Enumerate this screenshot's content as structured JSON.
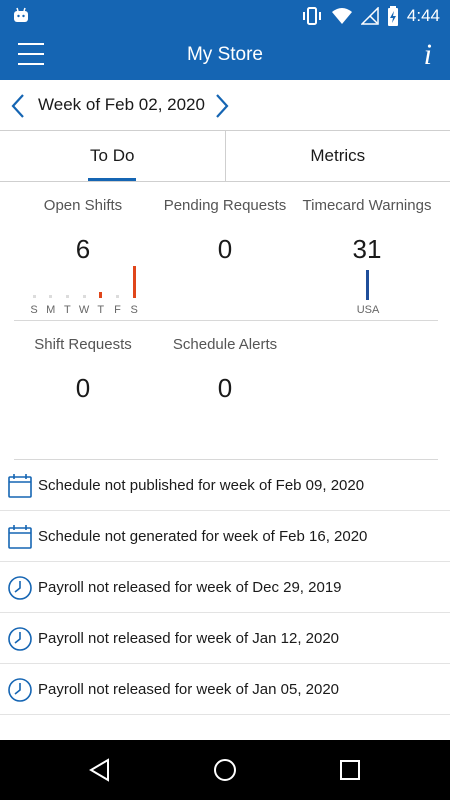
{
  "status_bar": {
    "time": "4:44"
  },
  "app_bar": {
    "title": "My Store",
    "info_icon": "i"
  },
  "week_nav": {
    "label": "Week of Feb 02, 2020"
  },
  "tabs": [
    {
      "label": "To Do",
      "active": true
    },
    {
      "label": "Metrics",
      "active": false
    }
  ],
  "summary": {
    "open_shifts": {
      "label": "Open Shifts",
      "value": "6"
    },
    "pending_requests": {
      "label": "Pending Requests",
      "value": "0"
    },
    "timecard_warnings": {
      "label": "Timecard Warnings",
      "value": "31"
    },
    "shift_requests": {
      "label": "Shift Requests",
      "value": "0"
    },
    "schedule_alerts": {
      "label": "Schedule Alerts",
      "value": "0"
    }
  },
  "open_shifts_chart": {
    "days": [
      "S",
      "M",
      "T",
      "W",
      "T",
      "F",
      "S"
    ],
    "values": [
      0,
      0,
      0,
      0,
      1,
      0,
      5
    ],
    "color": "#e0461b"
  },
  "timecard_chart": {
    "label": "USA",
    "value": 31,
    "color": "#1f4e9a"
  },
  "alerts": [
    {
      "icon": "calendar-icon",
      "text": "Schedule not published for week of Feb 09, 2020"
    },
    {
      "icon": "calendar-icon",
      "text": "Schedule not generated for week of Feb 16, 2020"
    },
    {
      "icon": "clock-icon",
      "text": "Payroll not released for week of Dec 29, 2019"
    },
    {
      "icon": "clock-icon",
      "text": "Payroll not released for week of Jan 12, 2020"
    },
    {
      "icon": "clock-icon",
      "text": "Payroll not released for week of Jan 05, 2020"
    }
  ],
  "colors": {
    "primary": "#1565b3",
    "accent_red": "#e0461b"
  }
}
